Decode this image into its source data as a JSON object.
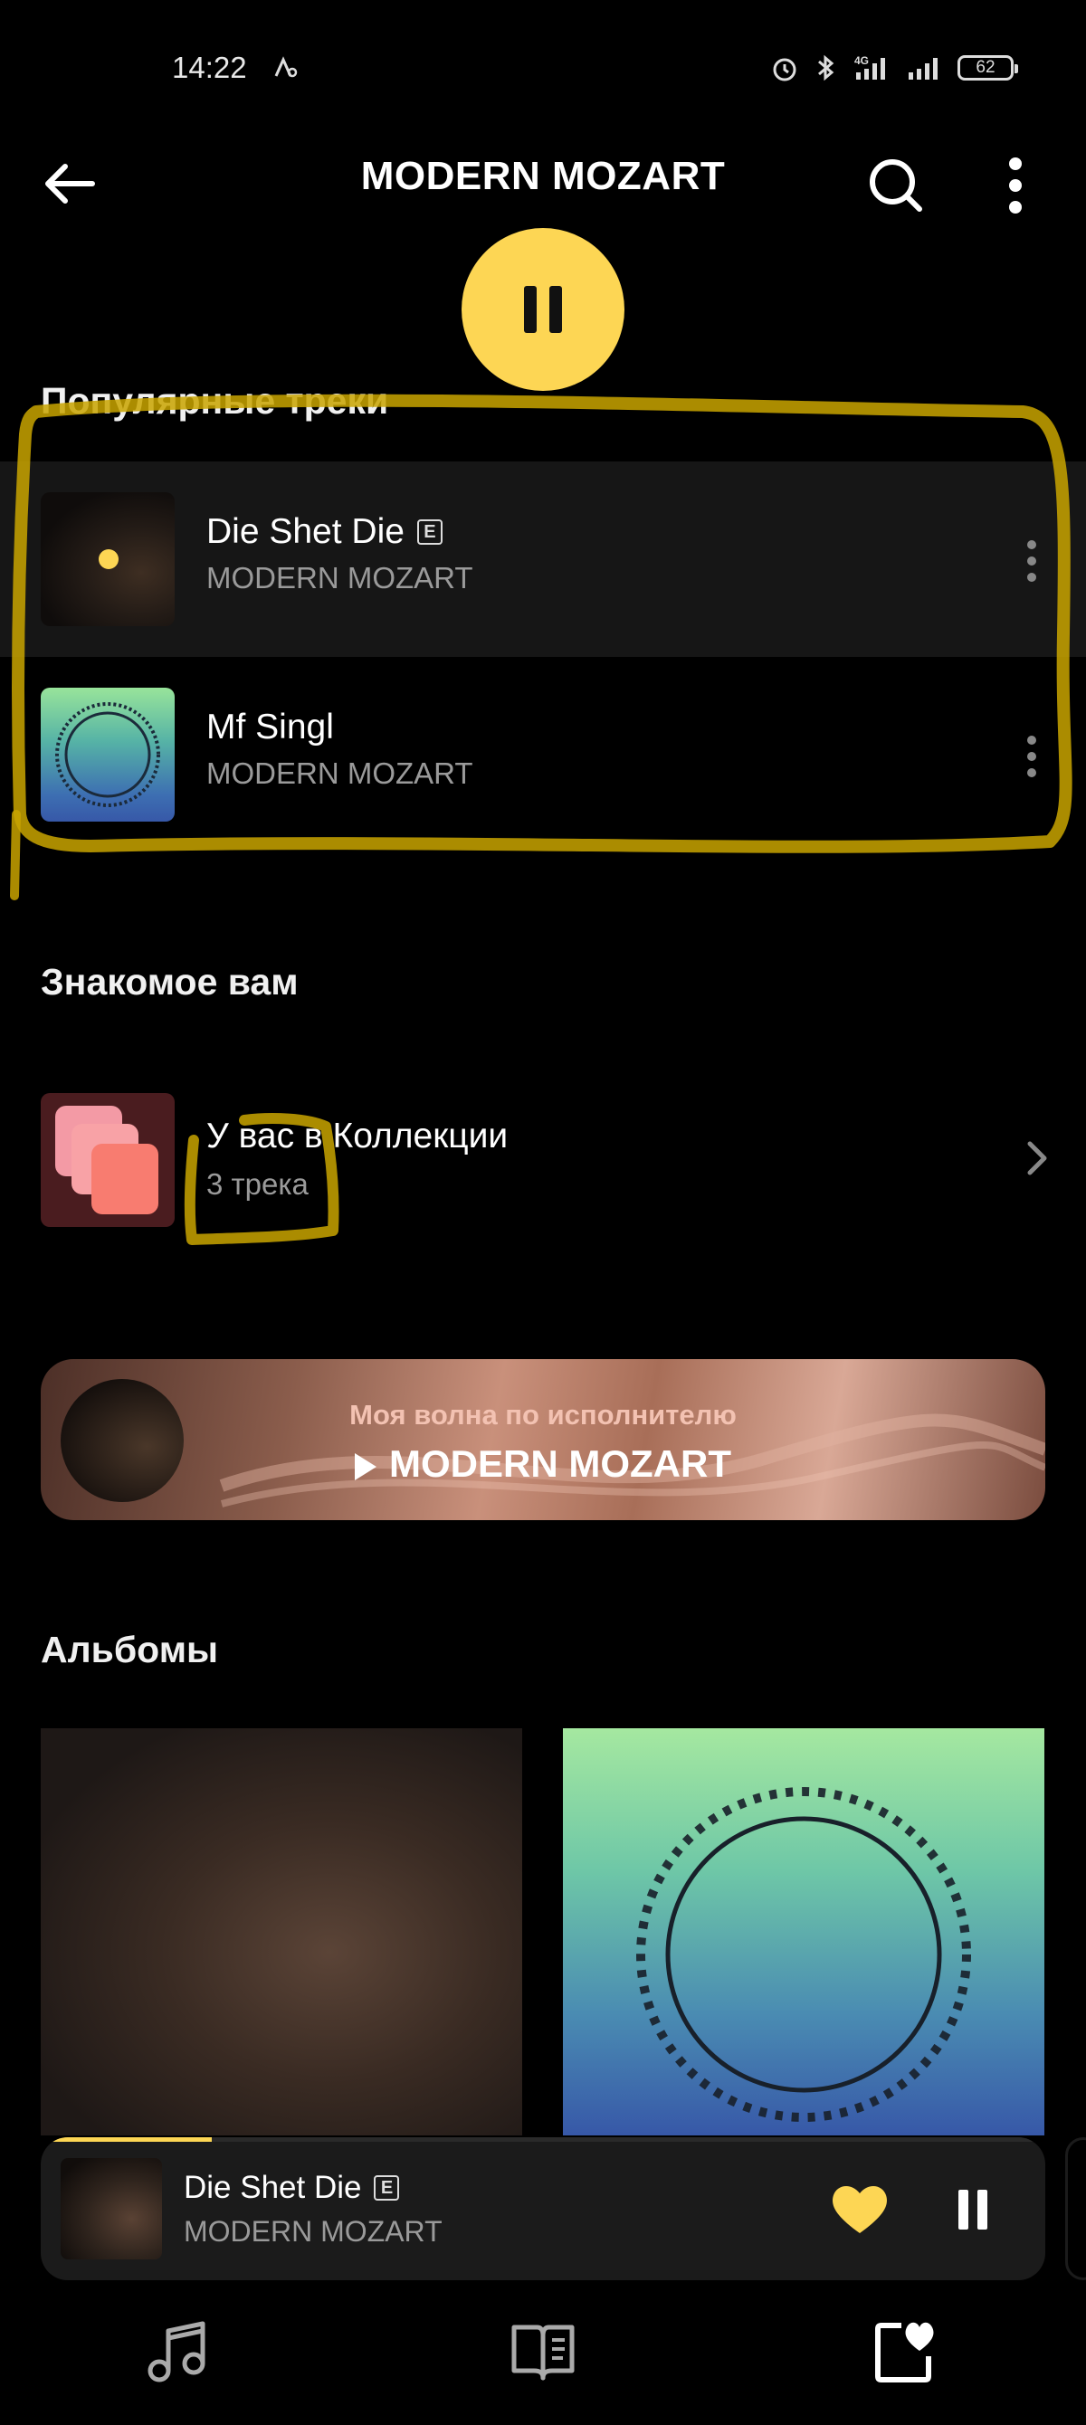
{
  "status_bar": {
    "time": "14:22",
    "battery": "62",
    "network": "4G"
  },
  "header": {
    "title": "MODERN MOZART",
    "back_icon": "arrow-left-icon",
    "search_icon": "search-icon",
    "more_icon": "more-vertical-icon"
  },
  "popular": {
    "title": "Популярные треки",
    "tracks": [
      {
        "title": "Die Shet Die",
        "artist": "MODERN MOZART",
        "explicit": "E"
      },
      {
        "title": "Mf Singl",
        "artist": "MODERN MOZART",
        "explicit": ""
      }
    ]
  },
  "familiar": {
    "title": "Знакомое вам",
    "collection_title": "У вас в Коллекции",
    "collection_count": "3 трека"
  },
  "wave": {
    "subtitle": "Моя волна по исполнителю",
    "title": "MODERN MOZART"
  },
  "albums": {
    "title": "Альбомы"
  },
  "mini_player": {
    "title": "Die Shet Die",
    "explicit": "E",
    "artist": "MODERN MOZART",
    "progress": 0.17
  },
  "colors": {
    "accent": "#fdd654",
    "background": "#000000"
  },
  "bottom_nav": [
    "music-note-icon",
    "book-icon",
    "collection-heart-icon"
  ]
}
